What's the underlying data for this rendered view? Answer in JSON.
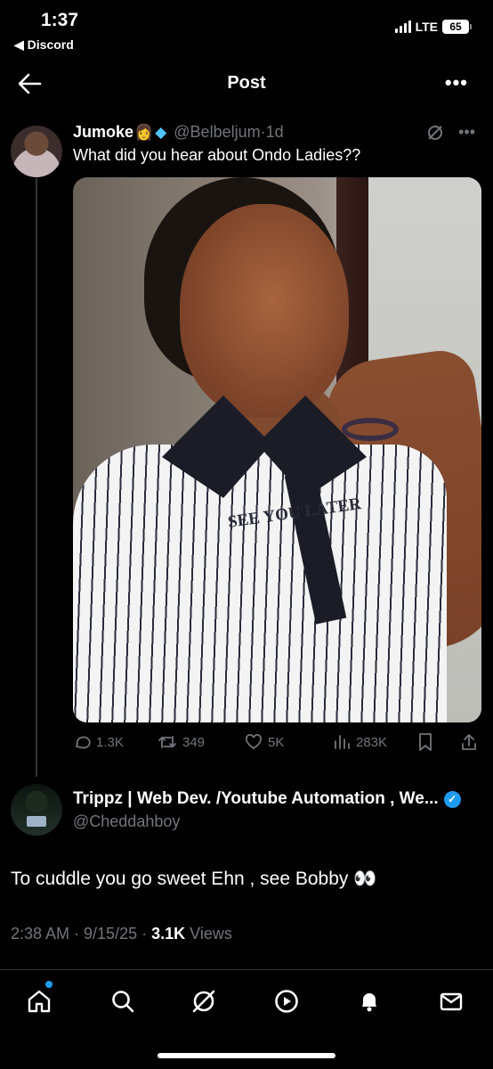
{
  "status_bar": {
    "time": "1:37",
    "back_app": "◀ Discord",
    "network": "LTE",
    "battery": "65"
  },
  "header": {
    "title": "Post"
  },
  "post": {
    "author_name": "Jumoke",
    "author_emoji": "👩",
    "author_badge_icon": "gem-icon",
    "handle": "@Belbeljum",
    "dot": "·",
    "time": "1d",
    "text": "What did you hear about Ondo Ladies??",
    "photo_text": "SEE YOU LATER",
    "stats": {
      "replies": "1.3K",
      "reposts": "349",
      "likes": "5K",
      "views": "283K"
    }
  },
  "reply": {
    "author_name": "Trippz | Web Dev. /Youtube Automation , We...",
    "handle": "@Cheddahboy",
    "text": "To cuddle you go sweet Ehn , see Bobby 👀",
    "timestamp": "2:38 AM · 9/15/25 ·",
    "views_count": "3.1K",
    "views_label": "Views"
  },
  "colors": {
    "background": "#000000",
    "accent": "#1d9bf0",
    "muted": "#71767b"
  }
}
